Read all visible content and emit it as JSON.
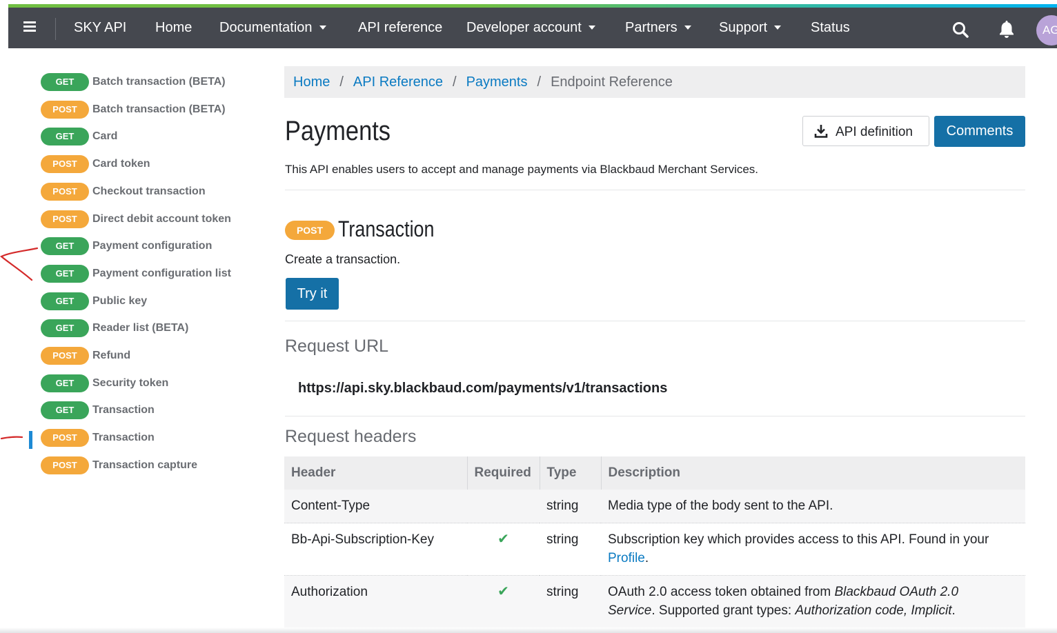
{
  "topnav": {
    "brand": "SKY API",
    "items": [
      {
        "label": "Home",
        "dropdown": false
      },
      {
        "label": "Documentation",
        "dropdown": true
      },
      {
        "label": "API reference",
        "dropdown": false
      },
      {
        "label": "Developer account",
        "dropdown": true
      },
      {
        "label": "Partners",
        "dropdown": true
      },
      {
        "label": "Support",
        "dropdown": true
      },
      {
        "label": "Status",
        "dropdown": false
      }
    ],
    "avatar_initials": "AG",
    "accent_colors": [
      "#71bf43",
      "#00b4f1"
    ],
    "bar_color": "#45484f"
  },
  "sidebar": {
    "items": [
      {
        "method": "GET",
        "label": "Batch transaction (BETA)"
      },
      {
        "method": "POST",
        "label": "Batch transaction (BETA)"
      },
      {
        "method": "GET",
        "label": "Card"
      },
      {
        "method": "POST",
        "label": "Card token"
      },
      {
        "method": "POST",
        "label": "Checkout transaction"
      },
      {
        "method": "POST",
        "label": "Direct debit account token"
      },
      {
        "method": "GET",
        "label": "Payment configuration"
      },
      {
        "method": "GET",
        "label": "Payment configuration list"
      },
      {
        "method": "GET",
        "label": "Public key"
      },
      {
        "method": "GET",
        "label": "Reader list (BETA)"
      },
      {
        "method": "POST",
        "label": "Refund"
      },
      {
        "method": "GET",
        "label": "Security token"
      },
      {
        "method": "GET",
        "label": "Transaction"
      },
      {
        "method": "POST",
        "label": "Transaction"
      },
      {
        "method": "POST",
        "label": "Transaction capture"
      }
    ],
    "active_index": 13,
    "get_color": "#3aa55a",
    "post_color": "#f4a83b"
  },
  "breadcrumb": {
    "items": [
      "Home",
      "API Reference",
      "Payments"
    ],
    "current": "Endpoint Reference",
    "separator": "/"
  },
  "page": {
    "title": "Payments",
    "api_definition_label": "API definition",
    "comments_label": "Comments",
    "description": "This API enables users to accept and manage payments via Blackbaud Merchant Services."
  },
  "endpoint": {
    "method": "POST",
    "title": "Transaction",
    "description": "Create a transaction.",
    "try_label": "Try it",
    "request_url_heading": "Request URL",
    "request_url": "https://api.sky.blackbaud.com/payments/v1/transactions",
    "request_headers_heading": "Request headers"
  },
  "headers_table": {
    "columns": [
      "Header",
      "Required",
      "Type",
      "Description"
    ],
    "rows": [
      {
        "header": "Content-Type",
        "required": false,
        "type": "string",
        "description": "Media type of the body sent to the API."
      },
      {
        "header": "Bb-Api-Subscription-Key",
        "required": true,
        "type": "string",
        "description": "Subscription key which provides access to this API. Found in your",
        "link": "Profile",
        "after": "."
      },
      {
        "header": "Authorization",
        "required": true,
        "type": "string",
        "desc_parts": [
          "OAuth 2.0 access token obtained from ",
          "Blackbaud OAuth 2.0 Service",
          ". Supported grant types: ",
          "Authorization code, Implicit",
          "."
        ]
      }
    ],
    "check_glyph": "✔"
  }
}
